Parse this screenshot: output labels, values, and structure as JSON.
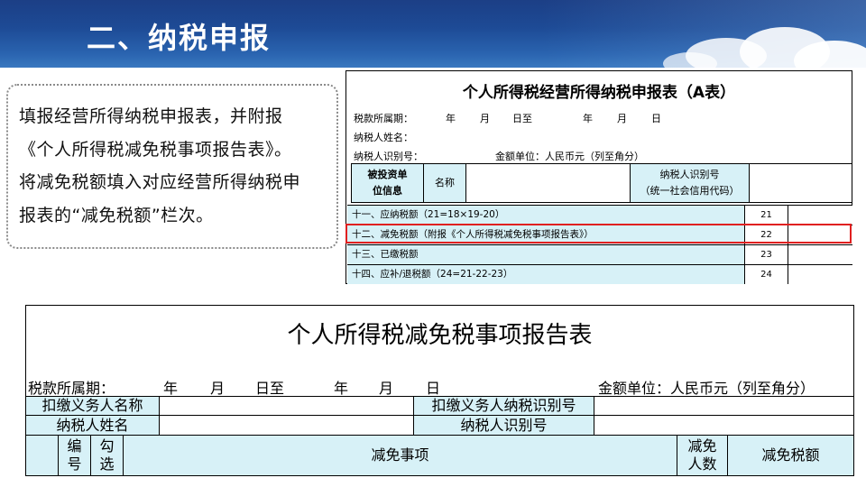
{
  "header": {
    "title": "二、纳税申报"
  },
  "instruction": {
    "lines": [
      "填报经营所得纳税申报表，并附报",
      "《个人所得税减免税事项报告表》。",
      "将减免税额填入对应经营所得纳税申",
      "报表的“减免税额”栏次。"
    ]
  },
  "form_a": {
    "title": "个人所得税经营所得纳税申报表（A表）",
    "period_label": "税款所属期：",
    "year1": "年",
    "month1": "月",
    "day_to": "日至",
    "year2": "年",
    "month2": "月",
    "day2": "日",
    "taxpayer_name_label": "纳税人姓名：",
    "taxpayer_id_label": "纳税人识别号：",
    "currency_label": "金额单位：人民币元（列至角分）",
    "investee_line1": "被投资单",
    "investee_line2": "位信息",
    "name_label": "名称",
    "id_label_line1": "纳税人识别号",
    "id_label_line2": "（统一社会信用代码）",
    "rows": [
      {
        "label": "十一、应纳税额（21=18×19-20）",
        "num": "21"
      },
      {
        "label": "十二、减免税额（附报《个人所得税减免税事项报告表》）",
        "num": "22"
      },
      {
        "label": "十三、已缴税额",
        "num": "23"
      },
      {
        "label": "十四、应补/退税额（24=21-22-23）",
        "num": "24"
      }
    ]
  },
  "form_b": {
    "title": "个人所得税减免税事项报告表",
    "period_label": "税款所属期：",
    "year1": "年",
    "month1": "月",
    "day_to": "日至",
    "year2": "年",
    "month2": "月",
    "day2": "日",
    "currency_label": "金额单位：人民币元（列至角分）",
    "withholder_name": "扣缴义务人名称",
    "withholder_id": "扣缴义务人纳税识别号",
    "taxpayer_name": "纳税人姓名",
    "taxpayer_id": "纳税人识别号",
    "col_no_line1": "编",
    "col_no_line2": "号",
    "col_check_line1": "勾",
    "col_check_line2": "选",
    "col_item": "减免事项",
    "col_count_line1": "减免",
    "col_count_line2": "人数",
    "col_amount": "减免税额"
  },
  "colors": {
    "banner": "#1d4a95",
    "cell_fill": "#d7f1f7",
    "highlight": "#e02020"
  }
}
